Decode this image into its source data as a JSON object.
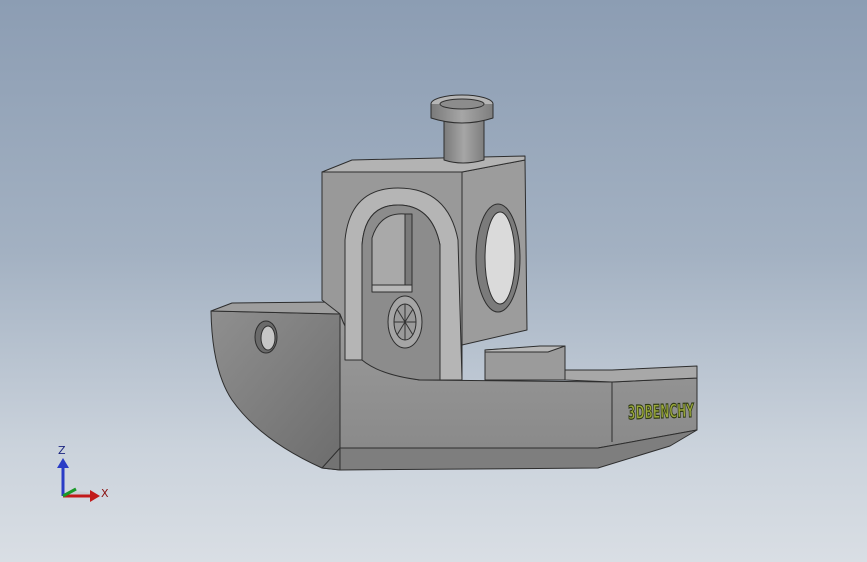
{
  "viewport": {
    "model": {
      "hull_text": "3DBENCHY"
    },
    "triad": {
      "z_label": "Z",
      "x_label": "X",
      "z_color": "#2a3cc6",
      "x_color": "#c21a1a",
      "y_color": "#1a9a2a"
    }
  }
}
